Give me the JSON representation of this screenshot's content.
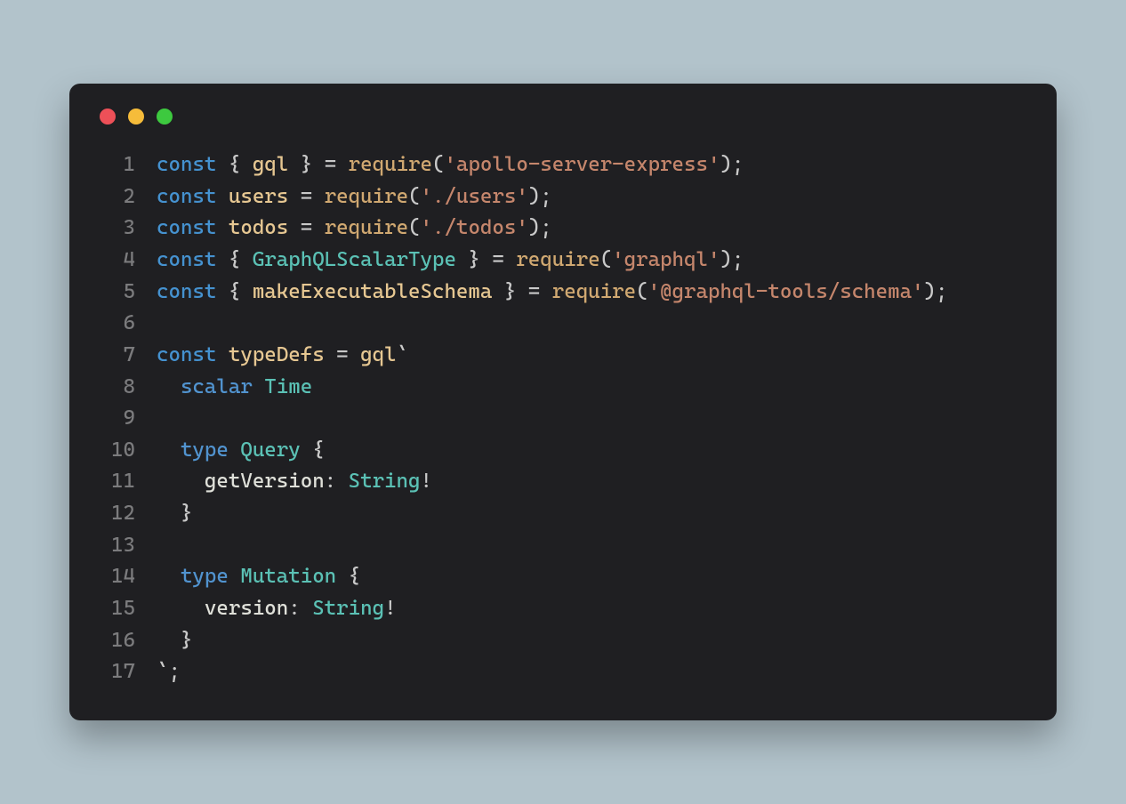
{
  "colors": {
    "bg_page": "#b2c3cb",
    "bg_window": "#1f1f22",
    "traffic_red": "#ed5058",
    "traffic_yellow": "#f6bc3a",
    "traffic_green": "#3dc93f",
    "gutter": "#7b7b7d",
    "default": "#c9c9c9",
    "keyword": "#4592d0",
    "identifier": "#e6c792",
    "class": "#5bc1b5",
    "function": "#d0a871",
    "string": "#c5866c"
  },
  "lines": [
    {
      "n": "1",
      "segs": [
        [
          "kw",
          "const"
        ],
        [
          "punct",
          " { "
        ],
        [
          "ident",
          "gql"
        ],
        [
          "punct",
          " } = "
        ],
        [
          "fn",
          "require"
        ],
        [
          "punct",
          "("
        ],
        [
          "str",
          "'apollo-server-express'"
        ],
        [
          "punct",
          ");"
        ]
      ]
    },
    {
      "n": "2",
      "segs": [
        [
          "kw",
          "const"
        ],
        [
          "punct",
          " "
        ],
        [
          "ident",
          "users"
        ],
        [
          "punct",
          " = "
        ],
        [
          "fn",
          "require"
        ],
        [
          "punct",
          "("
        ],
        [
          "str",
          "'./users'"
        ],
        [
          "punct",
          ");"
        ]
      ]
    },
    {
      "n": "3",
      "segs": [
        [
          "kw",
          "const"
        ],
        [
          "punct",
          " "
        ],
        [
          "ident",
          "todos"
        ],
        [
          "punct",
          " = "
        ],
        [
          "fn",
          "require"
        ],
        [
          "punct",
          "("
        ],
        [
          "str",
          "'./todos'"
        ],
        [
          "punct",
          ");"
        ]
      ]
    },
    {
      "n": "4",
      "segs": [
        [
          "kw",
          "const"
        ],
        [
          "punct",
          " { "
        ],
        [
          "class",
          "GraphQLScalarType"
        ],
        [
          "punct",
          " } = "
        ],
        [
          "fn",
          "require"
        ],
        [
          "punct",
          "("
        ],
        [
          "str",
          "'graphql'"
        ],
        [
          "punct",
          ");"
        ]
      ]
    },
    {
      "n": "5",
      "segs": [
        [
          "kw",
          "const"
        ],
        [
          "punct",
          " { "
        ],
        [
          "ident",
          "makeExecutableSchema"
        ],
        [
          "punct",
          " } = "
        ],
        [
          "fn",
          "require"
        ],
        [
          "punct",
          "("
        ],
        [
          "str",
          "'@graphql-tools/schema'"
        ],
        [
          "punct",
          ");"
        ]
      ]
    },
    {
      "n": "6",
      "segs": [
        [
          "punct",
          ""
        ]
      ]
    },
    {
      "n": "7",
      "segs": [
        [
          "kw",
          "const"
        ],
        [
          "punct",
          " "
        ],
        [
          "ident",
          "typeDefs"
        ],
        [
          "punct",
          " = "
        ],
        [
          "ident",
          "gql"
        ],
        [
          "punct",
          "`"
        ]
      ]
    },
    {
      "n": "8",
      "segs": [
        [
          "punct",
          "  "
        ],
        [
          "gqlkw",
          "scalar"
        ],
        [
          "punct",
          " "
        ],
        [
          "type",
          "Time"
        ]
      ]
    },
    {
      "n": "9",
      "segs": [
        [
          "punct",
          ""
        ]
      ]
    },
    {
      "n": "10",
      "segs": [
        [
          "punct",
          "  "
        ],
        [
          "gqlkw",
          "type"
        ],
        [
          "punct",
          " "
        ],
        [
          "type",
          "Query"
        ],
        [
          "punct",
          " {"
        ]
      ]
    },
    {
      "n": "11",
      "segs": [
        [
          "punct",
          "    "
        ],
        [
          "field",
          "getVersion"
        ],
        [
          "punct",
          ": "
        ],
        [
          "type",
          "String"
        ],
        [
          "punct",
          "!"
        ]
      ]
    },
    {
      "n": "12",
      "segs": [
        [
          "punct",
          "  }"
        ]
      ]
    },
    {
      "n": "13",
      "segs": [
        [
          "punct",
          ""
        ]
      ]
    },
    {
      "n": "14",
      "segs": [
        [
          "punct",
          "  "
        ],
        [
          "gqlkw",
          "type"
        ],
        [
          "punct",
          " "
        ],
        [
          "type",
          "Mutation"
        ],
        [
          "punct",
          " {"
        ]
      ]
    },
    {
      "n": "15",
      "segs": [
        [
          "punct",
          "    "
        ],
        [
          "field",
          "version"
        ],
        [
          "punct",
          ": "
        ],
        [
          "type",
          "String"
        ],
        [
          "punct",
          "!"
        ]
      ]
    },
    {
      "n": "16",
      "segs": [
        [
          "punct",
          "  }"
        ]
      ]
    },
    {
      "n": "17",
      "segs": [
        [
          "punct",
          "`;"
        ]
      ]
    }
  ]
}
